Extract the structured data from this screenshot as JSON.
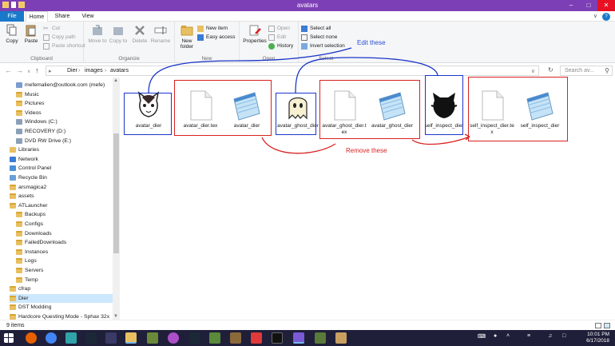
{
  "window": {
    "title": "avatars"
  },
  "tabs": {
    "file": "File",
    "home": "Home",
    "share": "Share",
    "view": "View"
  },
  "ribbon": {
    "clipboard": {
      "copy": "Copy",
      "paste": "Paste",
      "cut": "Cut",
      "copy_path": "Copy path",
      "paste_shortcut": "Paste shortcut",
      "label": "Clipboard"
    },
    "organize": {
      "move_to": "Move to",
      "copy_to": "Copy to",
      "delete": "Delete",
      "rename": "Rename",
      "label": "Organize"
    },
    "new": {
      "new_folder": "New folder",
      "new_item": "New item",
      "easy_access": "Easy access",
      "label": "New"
    },
    "open": {
      "properties": "Properties",
      "open": "Open",
      "edit": "Edit",
      "history": "History",
      "label": "Open"
    },
    "select": {
      "select_all": "Select all",
      "select_none": "Select none",
      "invert": "Invert selection",
      "label": "Select"
    }
  },
  "annotations": {
    "edit_these": "Edit these",
    "remove_these": "Remove these"
  },
  "address": {
    "crumbs": [
      "Dier",
      "images",
      "avatars"
    ],
    "search_placeholder": "Search av..."
  },
  "nav": [
    {
      "label": "mefemalien@outlook.com (mefe)",
      "kind": "user"
    },
    {
      "label": "Music",
      "kind": "folder"
    },
    {
      "label": "Pictures",
      "kind": "folder"
    },
    {
      "label": "Videos",
      "kind": "folder"
    },
    {
      "label": "Windows (C:)",
      "kind": "drive"
    },
    {
      "label": "RECOVERY (D:)",
      "kind": "drive"
    },
    {
      "label": "DVD RW Drive (E:)",
      "kind": "drive"
    },
    {
      "label": "Libraries",
      "kind": "lib"
    },
    {
      "label": "Network",
      "kind": "net"
    },
    {
      "label": "Control Panel",
      "kind": "cp"
    },
    {
      "label": "Recycle Bin",
      "kind": "bin"
    },
    {
      "label": "arsmagica2",
      "kind": "folder"
    },
    {
      "label": "assets",
      "kind": "folder"
    },
    {
      "label": "ATLauncher",
      "kind": "folder"
    },
    {
      "label": "Backups",
      "kind": "folder"
    },
    {
      "label": "Configs",
      "kind": "folder"
    },
    {
      "label": "Downloads",
      "kind": "folder"
    },
    {
      "label": "FailedDownloads",
      "kind": "folder"
    },
    {
      "label": "Instances",
      "kind": "folder"
    },
    {
      "label": "Logs",
      "kind": "folder"
    },
    {
      "label": "Servers",
      "kind": "folder"
    },
    {
      "label": "Temp",
      "kind": "folder"
    },
    {
      "label": "cfrap",
      "kind": "folder"
    },
    {
      "label": "Dier",
      "kind": "folder"
    },
    {
      "label": "DST Modding",
      "kind": "folder"
    },
    {
      "label": "Hardcore Questing Mode - Sphax 32x",
      "kind": "folder"
    }
  ],
  "files": [
    {
      "name": "avatar_dier",
      "type": "image-cat"
    },
    {
      "name": "avatar_dier.tex",
      "type": "blank"
    },
    {
      "name": "avatar_dier",
      "type": "notepad"
    },
    {
      "name": "avatar_ghost_dier",
      "type": "image-ghost"
    },
    {
      "name": "avatar_ghost_dier.tex",
      "type": "blank"
    },
    {
      "name": "avatar_ghost_dier",
      "type": "notepad"
    },
    {
      "name": "self_inspect_dier",
      "type": "image-silhouette"
    },
    {
      "name": "self_inspect_dier.tex",
      "type": "blank"
    },
    {
      "name": "self_inspect_dier",
      "type": "notepad"
    }
  ],
  "status": {
    "count": "9 items"
  },
  "clock": {
    "time": "10:01 PM",
    "date": "6/17/2018"
  }
}
